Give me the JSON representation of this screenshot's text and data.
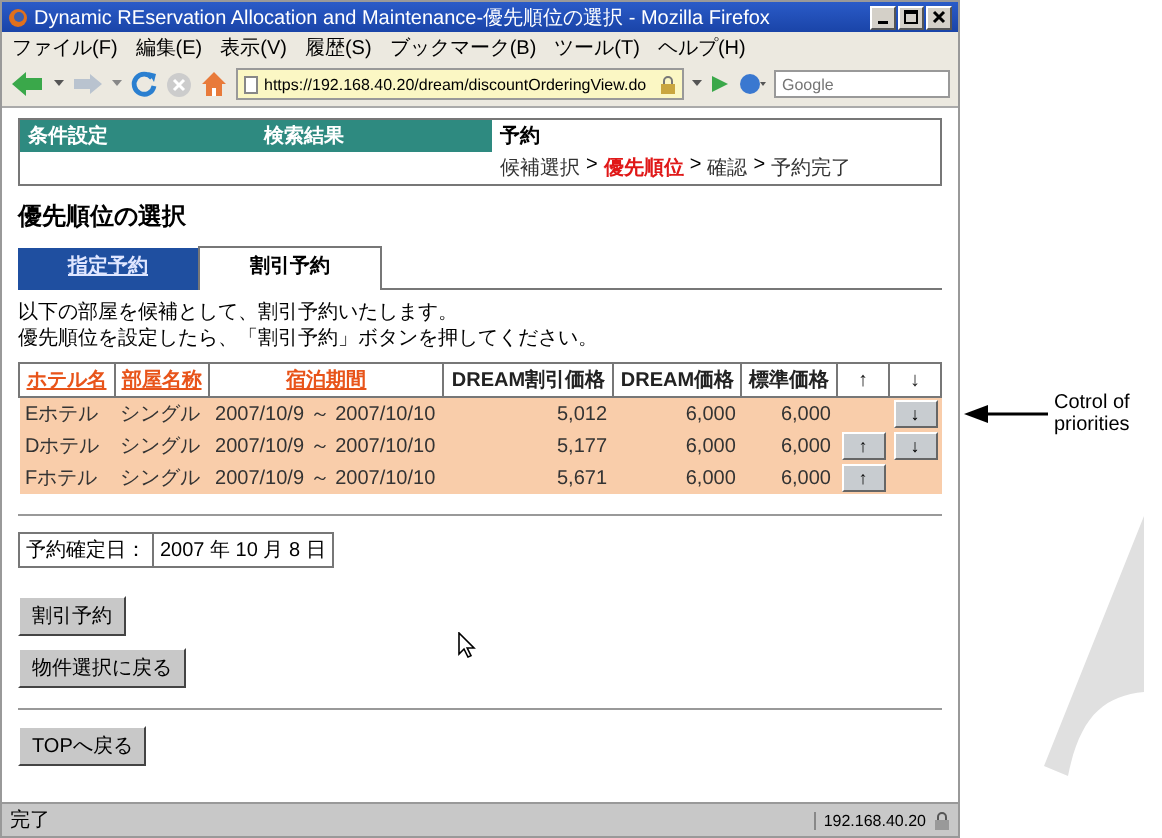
{
  "window": {
    "title": "Dynamic REservation Allocation and Maintenance-優先順位の選択 - Mozilla Firefox"
  },
  "menu": [
    "ファイル(F)",
    "編集(E)",
    "表示(V)",
    "履歴(S)",
    "ブックマーク(B)",
    "ツール(T)",
    "ヘルプ(H)"
  ],
  "address_bar": {
    "value": "https://192.168.40.20/dream/discountOrderingView.do"
  },
  "search": {
    "placeholder": "Google"
  },
  "steps": [
    {
      "label": "条件設定",
      "active": false
    },
    {
      "label": "検索結果",
      "active": false
    },
    {
      "label": "予約",
      "active": true
    }
  ],
  "sub_steps": [
    {
      "label": "候補選択",
      "current": false
    },
    {
      "label": "優先順位",
      "current": true
    },
    {
      "label": "確認",
      "current": false
    },
    {
      "label": "予約完了",
      "current": false
    }
  ],
  "sub_step_separator": ">",
  "heading": "優先順位の選択",
  "tabs": [
    {
      "label": "指定予約",
      "selected": false
    },
    {
      "label": "割引予約",
      "selected": true
    }
  ],
  "instructions": [
    "以下の部屋を候補として、割引予約いたします。",
    "優先順位を設定したら、「割引予約」ボタンを押してください。"
  ],
  "table": {
    "columns": [
      {
        "label": "ホテル名",
        "sortable": true
      },
      {
        "label": "部屋名称",
        "sortable": true
      },
      {
        "label": "宿泊期間",
        "sortable": true
      },
      {
        "label": "DREAM割引価格",
        "sortable": false
      },
      {
        "label": "DREAM価格",
        "sortable": false
      },
      {
        "label": "標準価格",
        "sortable": false
      },
      {
        "label": "↑",
        "sortable": false
      },
      {
        "label": "↓",
        "sortable": false
      }
    ],
    "rows": [
      {
        "hotel": "Eホテル",
        "room": "シングル",
        "period": "2007/10/9 ～ 2007/10/10",
        "discount_price": "5,012",
        "dream_price": "6,000",
        "standard_price": "6,000",
        "down": "↓"
      },
      {
        "hotel": "Dホテル",
        "room": "シングル",
        "period": "2007/10/9 ～ 2007/10/10",
        "discount_price": "5,177",
        "dream_price": "6,000",
        "standard_price": "6,000",
        "up": "↑",
        "down": "↓"
      },
      {
        "hotel": "Fホテル",
        "room": "シングル",
        "period": "2007/10/9 ～ 2007/10/10",
        "discount_price": "5,671",
        "dream_price": "6,000",
        "standard_price": "6,000",
        "up": "↑"
      }
    ]
  },
  "confirm_date": {
    "label": "予約確定日：",
    "value": "2007 年 10 月 8 日"
  },
  "buttons": [
    "割引予約",
    "物件選択に戻る"
  ],
  "top_button": "TOPへ戻る",
  "status_bar": {
    "text": "完了",
    "host": "192.168.40.20"
  },
  "annotation": {
    "text": "Cotrol of priorities"
  }
}
